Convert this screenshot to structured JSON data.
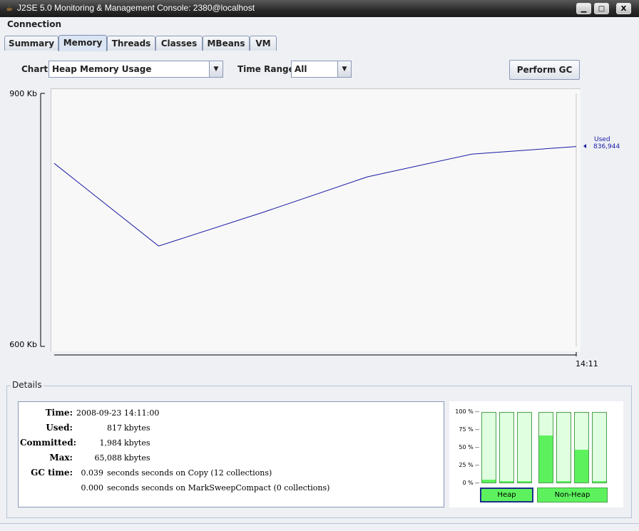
{
  "window": {
    "title": "J2SE 5.0 Monitoring & Management Console: 2380@localhost",
    "icon": "java-cup-icon",
    "minimize": "▁",
    "maximize": "□",
    "close": "X"
  },
  "menubar": {
    "connection": "Connection"
  },
  "tabs": [
    "Summary",
    "Memory",
    "Threads",
    "Classes",
    "MBeans",
    "VM"
  ],
  "active_tab": "Memory",
  "controls": {
    "chart_label": "Chart:",
    "chart_value": "Heap Memory Usage",
    "time_range_label": "Time Range:",
    "time_range_value": "All",
    "perform_gc": "Perform GC"
  },
  "chart_data": {
    "type": "line",
    "series": [
      {
        "name": "Used",
        "color": "#1a1aa6",
        "points": [
          [
            0,
            817
          ],
          [
            1,
            719
          ],
          [
            2,
            759
          ],
          [
            3,
            801
          ],
          [
            4,
            828
          ],
          [
            5,
            837
          ]
        ]
      }
    ],
    "ylim": [
      600,
      900
    ],
    "y_ticks": [
      "900 Kb",
      "600 Kb"
    ],
    "x_tick": "14:11",
    "annotation": {
      "label": "Used",
      "value": "836,944"
    }
  },
  "details": {
    "title": "Details",
    "rows": [
      {
        "key": "Time:",
        "value": "2008-09-23 14:11:00",
        "unit": ""
      },
      {
        "key": "Used:",
        "value": "817",
        "unit": "kbytes"
      },
      {
        "key": "Committed:",
        "value": "1,984",
        "unit": "kbytes"
      },
      {
        "key": "Max:",
        "value": "65,088",
        "unit": "kbytes"
      }
    ],
    "gc_label": "GC time:",
    "gc_rows": [
      {
        "value": "0.039",
        "text": "seconds seconds on Copy (12 collections)"
      },
      {
        "value": "0.000",
        "text": "seconds seconds on MarkSweepCompact (0 collections)"
      }
    ]
  },
  "pools": {
    "pct_labels": [
      "100 % --",
      "75 % --",
      "50 % --",
      "25 % --",
      "0 % --"
    ],
    "heap_fill": [
      0.04,
      0.02,
      0.02
    ],
    "nonheap_fill": [
      0.67,
      0.02,
      0.47,
      0.02
    ],
    "heap_label": "Heap",
    "nonheap_label": "Non-Heap"
  }
}
